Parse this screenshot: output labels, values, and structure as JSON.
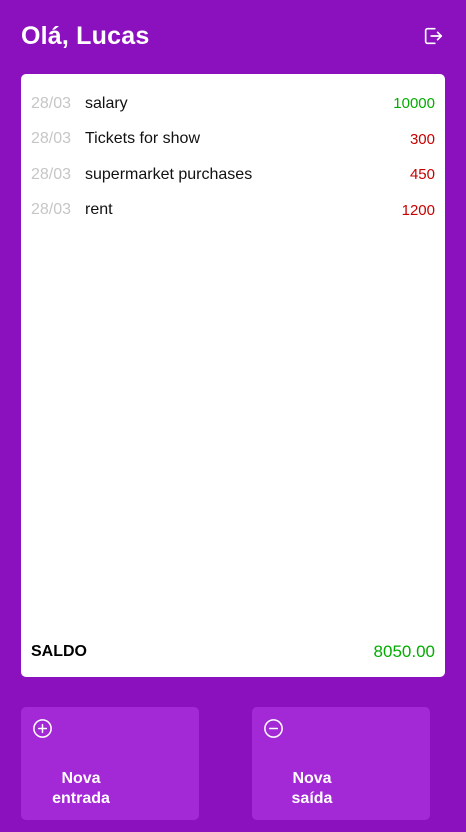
{
  "header": {
    "title": "Olá, Lucas",
    "logout_icon": "logout-icon"
  },
  "transactions": [
    {
      "date": "28/03",
      "description": "salary",
      "value": "10000",
      "type": "in"
    },
    {
      "date": "28/03",
      "description": "Tickets for show",
      "value": "300",
      "type": "out"
    },
    {
      "date": "28/03",
      "description": "supermarket purchases",
      "value": "450",
      "type": "out"
    },
    {
      "date": "28/03",
      "description": "rent",
      "value": "1200",
      "type": "out"
    }
  ],
  "balance": {
    "label": "SALDO",
    "value": "8050.00"
  },
  "actions": {
    "new_entry": {
      "label": "Nova\nentrada",
      "line1": "Nova",
      "line2": "entrada",
      "icon": "plus-circle-icon"
    },
    "new_exit": {
      "label": "Nova\nsaída",
      "line1": "Nova",
      "line2": "saída",
      "icon": "minus-circle-icon"
    }
  },
  "colors": {
    "background": "#8c11be",
    "button": "#a328d6",
    "income": "#03ac00",
    "expense": "#c70000",
    "date": "#c6c6c6"
  }
}
